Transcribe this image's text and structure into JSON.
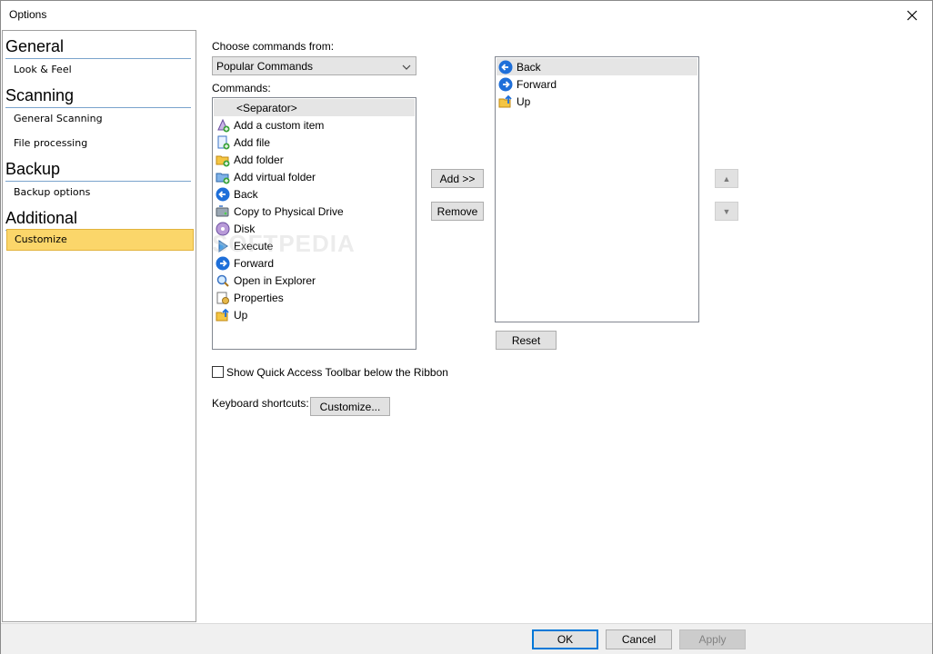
{
  "window": {
    "title": "Options"
  },
  "sidebar": {
    "groups": [
      {
        "label": "General",
        "items": [
          "Look & Feel"
        ]
      },
      {
        "label": "Scanning",
        "items": [
          "General Scanning",
          "File processing"
        ]
      },
      {
        "label": "Backup",
        "items": [
          "Backup options"
        ]
      },
      {
        "label": "Additional",
        "items": [
          "Customize"
        ]
      }
    ],
    "selected": "Customize"
  },
  "customize": {
    "choose_label": "Choose commands from:",
    "choose_value": "Popular Commands",
    "commands_label": "Commands:",
    "commands": [
      {
        "label": "<Separator>",
        "icon": "none"
      },
      {
        "label": "Add a custom item",
        "icon": "custom-item-icon"
      },
      {
        "label": "Add file",
        "icon": "add-file-icon"
      },
      {
        "label": "Add folder",
        "icon": "add-folder-icon"
      },
      {
        "label": "Add virtual folder",
        "icon": "add-virtual-folder-icon"
      },
      {
        "label": "Back",
        "icon": "back-arrow-icon"
      },
      {
        "label": "Copy to Physical Drive",
        "icon": "copy-drive-icon"
      },
      {
        "label": "Disk",
        "icon": "disk-icon"
      },
      {
        "label": "Execute",
        "icon": "execute-icon"
      },
      {
        "label": "Forward",
        "icon": "forward-arrow-icon"
      },
      {
        "label": "Open in Explorer",
        "icon": "explorer-icon"
      },
      {
        "label": "Properties",
        "icon": "properties-icon"
      },
      {
        "label": "Up",
        "icon": "up-folder-icon"
      }
    ],
    "toolbar_items": [
      {
        "label": "Back",
        "icon": "back-arrow-icon"
      },
      {
        "label": "Forward",
        "icon": "forward-arrow-icon"
      },
      {
        "label": "Up",
        "icon": "up-folder-icon"
      }
    ],
    "add_label": "Add >>",
    "remove_label": "Remove",
    "reset_label": "Reset",
    "move_up_symbol": "▲",
    "move_down_symbol": "▼",
    "quick_access_label": "Show Quick Access Toolbar below the Ribbon",
    "quick_access_checked": false,
    "shortcuts_label": "Keyboard shortcuts:",
    "shortcuts_button": "Customize..."
  },
  "footer": {
    "ok": "OK",
    "cancel": "Cancel",
    "apply": "Apply"
  },
  "colors": {
    "selection": "#fbd66a",
    "accent": "#0078d7",
    "arrow_blue": "#1e6fd9"
  }
}
